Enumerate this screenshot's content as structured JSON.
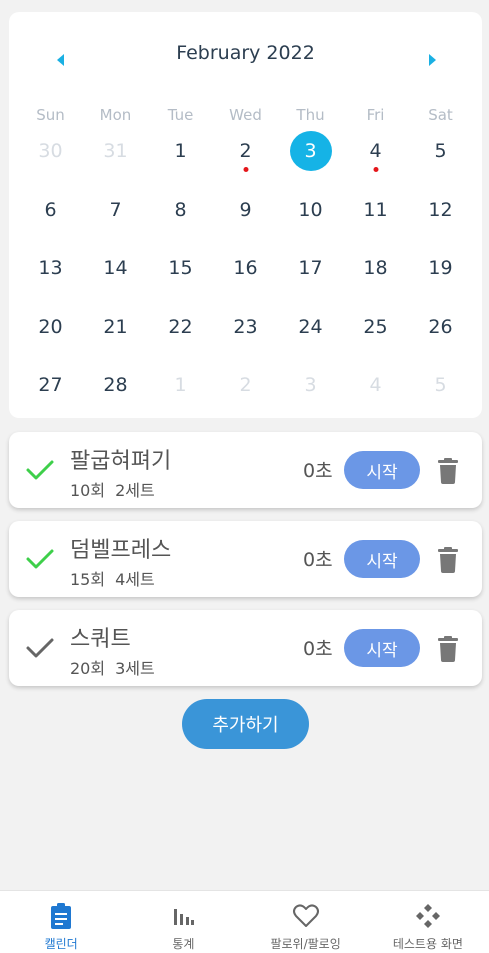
{
  "calendar": {
    "month_title": "February 2022",
    "weekdays": [
      "Sun",
      "Mon",
      "Tue",
      "Wed",
      "Thu",
      "Fri",
      "Sat"
    ],
    "days": [
      {
        "label": "30",
        "muted": true
      },
      {
        "label": "31",
        "muted": true
      },
      {
        "label": "1"
      },
      {
        "label": "2",
        "dot": true
      },
      {
        "label": "3",
        "selected": true
      },
      {
        "label": "4",
        "dot": true
      },
      {
        "label": "5"
      },
      {
        "label": "6"
      },
      {
        "label": "7"
      },
      {
        "label": "8"
      },
      {
        "label": "9"
      },
      {
        "label": "10"
      },
      {
        "label": "11"
      },
      {
        "label": "12"
      },
      {
        "label": "13"
      },
      {
        "label": "14"
      },
      {
        "label": "15"
      },
      {
        "label": "16"
      },
      {
        "label": "17"
      },
      {
        "label": "18"
      },
      {
        "label": "19"
      },
      {
        "label": "20"
      },
      {
        "label": "21"
      },
      {
        "label": "22"
      },
      {
        "label": "23"
      },
      {
        "label": "24"
      },
      {
        "label": "25"
      },
      {
        "label": "26"
      },
      {
        "label": "27"
      },
      {
        "label": "28"
      },
      {
        "label": "1",
        "muted": true
      },
      {
        "label": "2",
        "muted": true
      },
      {
        "label": "3",
        "muted": true
      },
      {
        "label": "4",
        "muted": true
      },
      {
        "label": "5",
        "muted": true
      }
    ],
    "accent_color": "#15b3e6",
    "dot_color": "#e4161b"
  },
  "workouts": [
    {
      "name": "팔굽혀펴기",
      "reps": "10회",
      "sets": "2세트",
      "time": "0초",
      "start_label": "시작",
      "done": true
    },
    {
      "name": "덤벨프레스",
      "reps": "15회",
      "sets": "4세트",
      "time": "0초",
      "start_label": "시작",
      "done": true
    },
    {
      "name": "스쿼트",
      "reps": "20회",
      "sets": "3세트",
      "time": "0초",
      "start_label": "시작",
      "done": false
    }
  ],
  "add_button_label": "추가하기",
  "bottom_nav": {
    "items": [
      {
        "label": "캘린더",
        "icon": "clipboard-icon",
        "active": true
      },
      {
        "label": "통계",
        "icon": "bar-chart-icon",
        "active": false
      },
      {
        "label": "팔로위/팔로잉",
        "icon": "heart-icon",
        "active": false
      },
      {
        "label": "테스트용 화면",
        "icon": "diamond-cluster-icon",
        "active": false
      }
    ]
  },
  "colors": {
    "check_done": "#3ecf4a",
    "check_pending": "#666666",
    "start_button": "#6b97e6",
    "add_button": "#3a95d8",
    "nav_active": "#1f78d1"
  }
}
